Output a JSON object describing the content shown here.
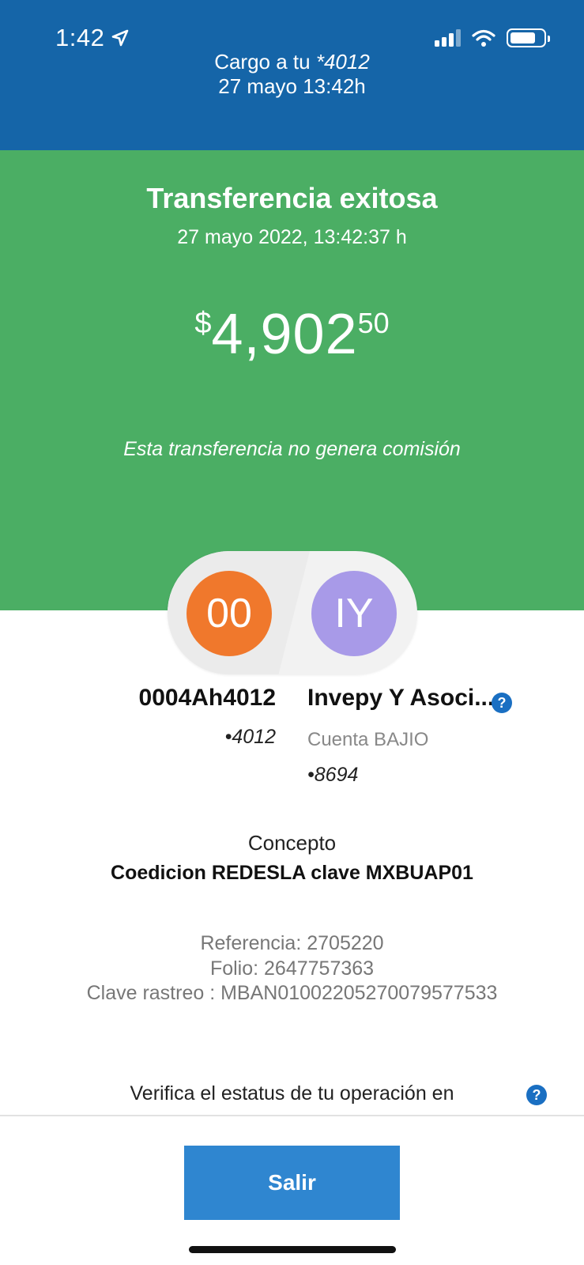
{
  "status_bar": {
    "time": "1:42"
  },
  "header": {
    "charge_prefix": "Cargo a tu ",
    "charge_account": "*4012",
    "date": "27 mayo 13:42h"
  },
  "result": {
    "title": "Transferencia exitosa",
    "datetime": "27 mayo 2022, 13:42:37 h",
    "amount_currency": "$",
    "amount_integer": "4,902",
    "amount_decimal": "50",
    "commission_note": "Esta transferencia no genera comisión"
  },
  "origin": {
    "initials": "00",
    "name": "0004Ah4012",
    "number": "4012"
  },
  "destination": {
    "initials": "IY",
    "name": "Invepy Y Asoci...",
    "bank": "Cuenta BAJIO",
    "number": "8694"
  },
  "concept": {
    "label": "Concepto",
    "value": "Coedicion REDESLA clave MXBUAP01"
  },
  "details": {
    "reference": "Referencia: 2705220",
    "folio": "Folio: 2647757363",
    "tracking": "Clave rastreo : MBAN01002205270079577533"
  },
  "verify_text": "Verifica el estatus de tu operación en",
  "help_glyph": "?",
  "bullet": "•",
  "exit_button": "Salir",
  "colors": {
    "header": "#1565a8",
    "success": "#4bae64",
    "button": "#2f86d0",
    "origin_avatar": "#f0782c",
    "destination_avatar": "#a89ae8"
  },
  "icons": [
    "location-arrow-icon",
    "cellular-signal-icon",
    "wifi-icon",
    "battery-icon",
    "help-icon"
  ]
}
